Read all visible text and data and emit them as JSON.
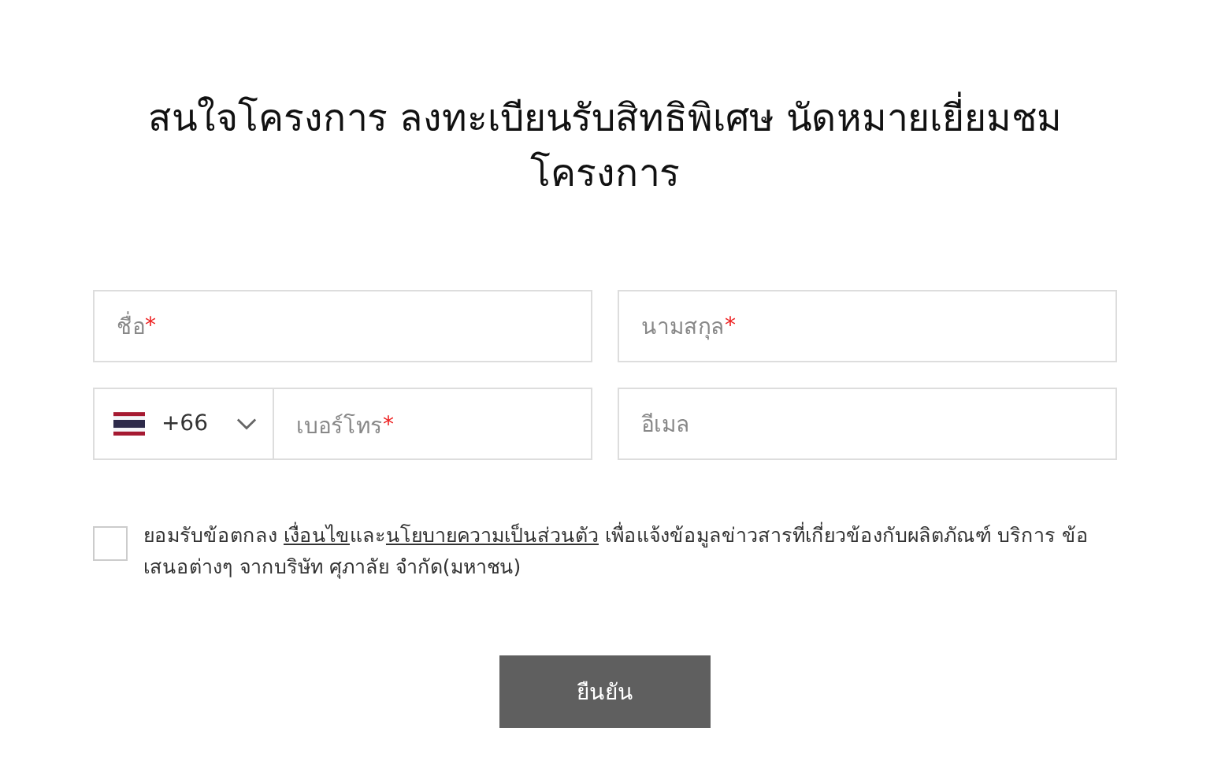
{
  "title": "สนใจโครงการ ลงทะเบียนรับสิทธิพิเศษ นัดหมายเยี่ยมชมโครงการ",
  "fields": [
    {
      "placeholder": "ชื่อ",
      "required_mark": "*"
    },
    {
      "placeholder": "นามสกุล",
      "required_mark": "*"
    },
    {
      "kind": "phone",
      "country_code": "+66",
      "placeholder": "เบอร์โทร",
      "required_mark": "*"
    },
    {
      "placeholder": "อีเมล"
    }
  ],
  "consent": {
    "checked": false,
    "parts": [
      {
        "kind": "text",
        "text": "ยอมรับข้อตกลง "
      },
      {
        "kind": "link",
        "text": "เงื่อนไข"
      },
      {
        "kind": "text",
        "text": "และ"
      },
      {
        "kind": "link",
        "text": "นโยบายความเป็นส่วนตัว"
      },
      {
        "kind": "text",
        "text": " เพื่อแจ้งข้อมูลข่าวสารที่เกี่ยวข้องกับผลิตภัณฑ์ บริการ ข้อเสนอต่างๆ จากบริษัท ศุภาลัย จำกัด(มหาชน)"
      }
    ]
  },
  "submit": "ยืนยัน"
}
